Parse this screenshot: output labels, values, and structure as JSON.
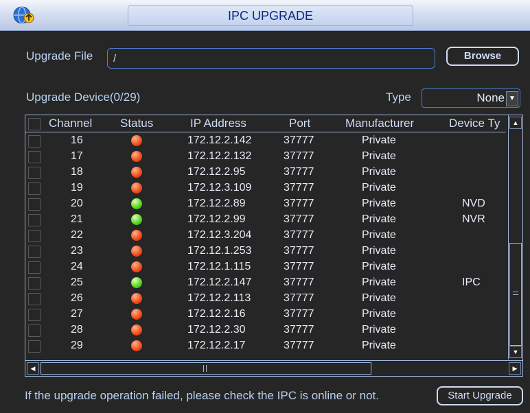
{
  "window": {
    "title": "IPC UPGRADE"
  },
  "upgrade_file": {
    "label": "Upgrade File",
    "value": "/",
    "browse_label": "Browse"
  },
  "device": {
    "label": "Upgrade Device(0/29)",
    "type_label": "Type",
    "type_value": "None"
  },
  "table": {
    "columns": [
      "Channel",
      "Status",
      "IP Address",
      "Port",
      "Manufacturer",
      "Device Ty"
    ],
    "rows": [
      {
        "channel": "16",
        "status": "offline",
        "ip": "172.12.2.142",
        "port": "37777",
        "manufacturer": "Private",
        "device_type": ""
      },
      {
        "channel": "17",
        "status": "offline",
        "ip": "172.12.2.132",
        "port": "37777",
        "manufacturer": "Private",
        "device_type": ""
      },
      {
        "channel": "18",
        "status": "offline",
        "ip": "172.12.2.95",
        "port": "37777",
        "manufacturer": "Private",
        "device_type": ""
      },
      {
        "channel": "19",
        "status": "offline",
        "ip": "172.12.3.109",
        "port": "37777",
        "manufacturer": "Private",
        "device_type": ""
      },
      {
        "channel": "20",
        "status": "online",
        "ip": "172.12.2.89",
        "port": "37777",
        "manufacturer": "Private",
        "device_type": "NVD"
      },
      {
        "channel": "21",
        "status": "online",
        "ip": "172.12.2.99",
        "port": "37777",
        "manufacturer": "Private",
        "device_type": "NVR"
      },
      {
        "channel": "22",
        "status": "offline",
        "ip": "172.12.3.204",
        "port": "37777",
        "manufacturer": "Private",
        "device_type": ""
      },
      {
        "channel": "23",
        "status": "offline",
        "ip": "172.12.1.253",
        "port": "37777",
        "manufacturer": "Private",
        "device_type": ""
      },
      {
        "channel": "24",
        "status": "offline",
        "ip": "172.12.1.115",
        "port": "37777",
        "manufacturer": "Private",
        "device_type": ""
      },
      {
        "channel": "25",
        "status": "online",
        "ip": "172.12.2.147",
        "port": "37777",
        "manufacturer": "Private",
        "device_type": "IPC"
      },
      {
        "channel": "26",
        "status": "offline",
        "ip": "172.12.2.113",
        "port": "37777",
        "manufacturer": "Private",
        "device_type": ""
      },
      {
        "channel": "27",
        "status": "offline",
        "ip": "172.12.2.16",
        "port": "37777",
        "manufacturer": "Private",
        "device_type": ""
      },
      {
        "channel": "28",
        "status": "offline",
        "ip": "172.12.2.30",
        "port": "37777",
        "manufacturer": "Private",
        "device_type": ""
      },
      {
        "channel": "29",
        "status": "offline",
        "ip": "172.12.2.17",
        "port": "37777",
        "manufacturer": "Private",
        "device_type": ""
      }
    ]
  },
  "footer": {
    "message": "If the upgrade operation failed, please check the IPC is online or not.",
    "start_label": "Start Upgrade"
  },
  "colors": {
    "accent": "#4b80d6",
    "title_text": "#0a2a8a",
    "online": "#55d31d",
    "offline": "#f24a1a"
  },
  "icons": {
    "logo": "globe-arrow-icon"
  }
}
